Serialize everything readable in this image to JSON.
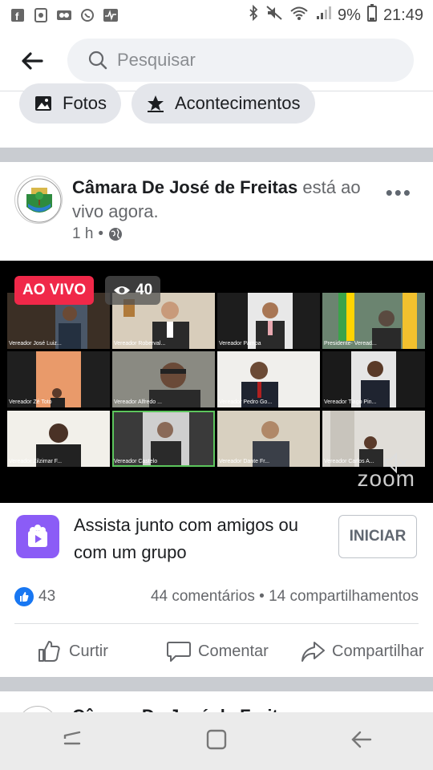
{
  "status_bar": {
    "battery": "9%",
    "time": "21:49"
  },
  "search": {
    "placeholder": "Pesquisar"
  },
  "chips": [
    {
      "label": "Fotos"
    },
    {
      "label": "Acontecimentos"
    }
  ],
  "post": {
    "page_name": "Câmara De José de Freitas",
    "status_text": "está ao vivo agora.",
    "time": "1 h",
    "live_badge": "AO VIVO",
    "viewer_count": "40",
    "video_logo": "zoom",
    "participants": [
      "Vereador José Luiz...",
      "Vereador Roberval...",
      "Vereador Pampa",
      "Presidente- Veread...",
      "Vereador Zé Toto",
      "Vereador Alfredo ...",
      "Vereador Pedro Go...",
      "Vereador Tiago Pin...",
      "Vereador Zilzimar F...",
      "Vereador Castelo",
      "Vereador Dante Fr...",
      "Vereador Carlos A..."
    ],
    "watch_together": {
      "text": "Assista junto com amigos ou com um grupo",
      "button": "INICIAR"
    },
    "reactions_count": "43",
    "comments": "44 comentários",
    "shares": "14 compartilhamentos",
    "actions": {
      "like": "Curtir",
      "comment": "Comentar",
      "share": "Compartilhar"
    }
  },
  "next_post": {
    "page_name": "Câmara De José de Freit..."
  },
  "colors": {
    "live_red": "#f02849",
    "facebook_blue": "#1877f2",
    "watch_purple": "#8b5cf6"
  }
}
